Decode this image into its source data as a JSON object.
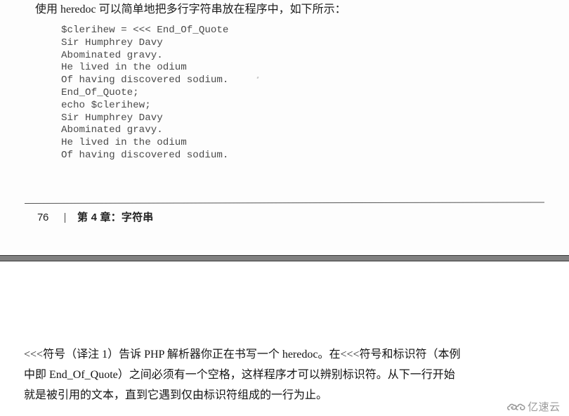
{
  "upper_page": {
    "intro": "使用 heredoc 可以简单地把多行字符串放在程序中，如下所示：",
    "code_lines": [
      "$clerihew = <<< End_Of_Quote",
      "Sir Humphrey Davy",
      "Abominated gravy.",
      "He lived in the odium",
      "Of having discovered sodium.",
      "End_Of_Quote;",
      "echo $clerihew;",
      "Sir Humphrey Davy",
      "Abominated gravy.",
      "He lived in the odium",
      "Of having discovered sodium."
    ],
    "footer": {
      "page_number": "76",
      "chapter_title": "第 4 章：字符串"
    }
  },
  "lower_page": {
    "paragraph_lines": [
      "<<<符号（译注 1）告诉 PHP 解析器你正在书写一个 heredoc。在<<<符号和标识符（本例",
      "中即 End_Of_Quote）之间必须有一个空格，这样程序才可以辨别标识符。从下一行开始",
      "就是被引用的文本，直到它遇到仅由标识符组成的一行为止。"
    ]
  },
  "watermark": {
    "icon": "cloud-logo-icon",
    "text": "亿速云"
  }
}
